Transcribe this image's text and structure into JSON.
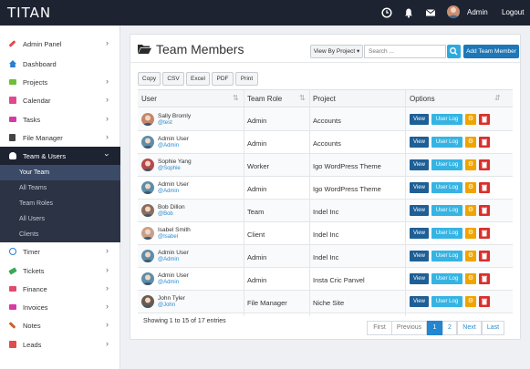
{
  "topbar": {
    "brand": "TITAN",
    "icons": [
      "clock-icon",
      "bell-icon",
      "envelope-icon"
    ],
    "user_name": "Admin",
    "logout": "Logout"
  },
  "sidebar": {
    "items": [
      {
        "label": "Admin Panel",
        "icon": "wrench-icon",
        "color": "#e44b4b"
      },
      {
        "label": "Dashboard",
        "icon": "home-icon",
        "color": "#2a7fd4"
      },
      {
        "label": "Projects",
        "icon": "folder-icon",
        "color": "#6bbf3a"
      },
      {
        "label": "Calendar",
        "icon": "calendar-icon",
        "color": "#e1498e"
      },
      {
        "label": "Tasks",
        "icon": "tasks-icon",
        "color": "#d63aa5"
      },
      {
        "label": "File Manager",
        "icon": "file-icon",
        "color": "#444444"
      },
      {
        "label": "Team & Users",
        "icon": "user-icon",
        "color": "#ffffff"
      },
      {
        "label": "Timer",
        "icon": "timer-icon",
        "color": "#2a7fd4"
      },
      {
        "label": "Tickets",
        "icon": "ticket-icon",
        "color": "#3aaa55"
      },
      {
        "label": "Finance",
        "icon": "finance-icon",
        "color": "#e14b6e"
      },
      {
        "label": "Invoices",
        "icon": "invoice-icon",
        "color": "#d63aa5"
      },
      {
        "label": "Notes",
        "icon": "pencil-icon",
        "color": "#c8632a"
      },
      {
        "label": "Leads",
        "icon": "leads-icon",
        "color": "#e14b4b"
      }
    ],
    "subitems": [
      "Your Team",
      "All Teams",
      "Team Roles",
      "All Users",
      "Clients"
    ]
  },
  "main": {
    "title": "Team Members",
    "view_by": "View By Project ▾",
    "search_placeholder": "Search ...",
    "add_button": "Add Team Member",
    "export_buttons": [
      "Copy",
      "CSV",
      "Excel",
      "PDF",
      "Print"
    ],
    "columns": [
      "User",
      "Team Role",
      "Project",
      "Options"
    ],
    "sort_arrows": [
      "⇅",
      "⇅",
      "⇵"
    ],
    "action_labels": {
      "view": "View",
      "log": "User Log",
      "gear": "⚙"
    },
    "rows": [
      {
        "name": "Sally Bromly",
        "handle": "@test",
        "role": "Admin",
        "project": "Accounts",
        "avatar_color": "#c4866a"
      },
      {
        "name": "Admin User",
        "handle": "@Admin",
        "role": "Admin",
        "project": "Accounts",
        "avatar_color": "#5c8ea8"
      },
      {
        "name": "Sophie Yang",
        "handle": "@Sophie",
        "role": "Worker",
        "project": "Igo WordPress Theme",
        "avatar_color": "#b54a4a"
      },
      {
        "name": "Admin User",
        "handle": "@Admin",
        "role": "Admin",
        "project": "Igo WordPress Theme",
        "avatar_color": "#5c8ea8"
      },
      {
        "name": "Bob Dillon",
        "handle": "@Bob",
        "role": "Team",
        "project": "Indel Inc",
        "avatar_color": "#8c6c5c"
      },
      {
        "name": "Isabel Smith",
        "handle": "@Isabel",
        "role": "Client",
        "project": "Indel Inc",
        "avatar_color": "#c8a08a"
      },
      {
        "name": "Admin User",
        "handle": "@Admin",
        "role": "Admin",
        "project": "Indel Inc",
        "avatar_color": "#5c8ea8"
      },
      {
        "name": "Admin User",
        "handle": "@Admin",
        "role": "Admin",
        "project": "Insta Cric Panvel",
        "avatar_color": "#5c8ea8"
      },
      {
        "name": "John Tyler",
        "handle": "@John",
        "role": "File Manager",
        "project": "Niche Site",
        "avatar_color": "#6b5a50"
      }
    ],
    "entries_text": "Showing 1 to 15 of 17 entries",
    "pagination": [
      "First",
      "Previous",
      "1",
      "2",
      "Next",
      "Last"
    ]
  }
}
